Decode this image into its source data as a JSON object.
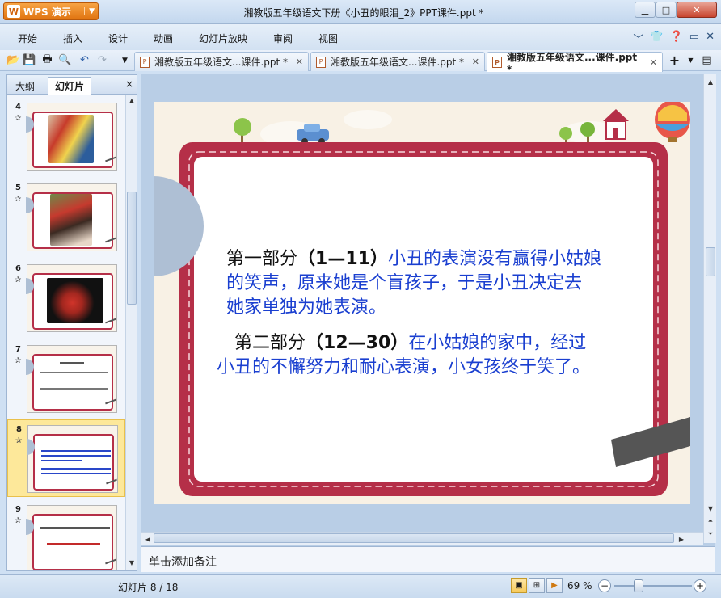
{
  "window": {
    "title": "湘教版五年级语文下册《小丑的眼泪_2》PPT课件.ppt *",
    "app_button": "WPS 演示",
    "app_logo": "W"
  },
  "menu": {
    "items": [
      "开始",
      "插入",
      "设计",
      "动画",
      "幻灯片放映",
      "审阅",
      "视图"
    ]
  },
  "tabs": [
    {
      "label": "湘教版五年级语文...课件.ppt *",
      "active": false
    },
    {
      "label": "湘教版五年级语文...课件.ppt *",
      "active": false
    },
    {
      "label": "湘教版五年级语文...课件.ppt *",
      "active": true
    }
  ],
  "left_pane": {
    "tab_outline": "大纲",
    "tab_slides": "幻灯片",
    "close": "×",
    "thumbnails": [
      {
        "num": "4",
        "selected": false
      },
      {
        "num": "5",
        "selected": false
      },
      {
        "num": "6",
        "selected": false
      },
      {
        "num": "7",
        "selected": false
      },
      {
        "num": "8",
        "selected": true
      },
      {
        "num": "9",
        "selected": false
      }
    ]
  },
  "slide": {
    "part1_label": "第一部分",
    "part1_range": "（1—11）",
    "part1_text_a": "小丑的表演没有赢得小姑娘",
    "part1_text_b": "的笑声，原来她是个盲孩子，于是小丑决定去",
    "part1_text_c": "她家单独为她表演。",
    "part2_label": "第二部分",
    "part2_range": "（12—30）",
    "part2_text_a": "在小姑娘的家中，经过",
    "part2_text_b": "小丑的不懈努力和耐心表演，小女孩终于笑了。"
  },
  "notes": {
    "placeholder": "单击添加备注"
  },
  "status": {
    "slide_count": "幻灯片 8 / 18",
    "zoom": "69 %"
  },
  "colors": {
    "frame_red": "#b52f48",
    "text_blue": "#1a3fd0",
    "accent_orange": "#e07410"
  }
}
